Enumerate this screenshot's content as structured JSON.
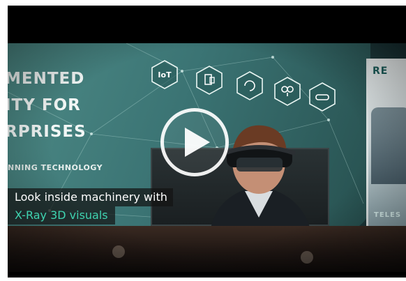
{
  "video": {
    "banner_headline_lines": [
      "MENTED",
      "ITY FOR",
      "RPRISES"
    ],
    "banner_subline": "NNING TECHNOLOGY",
    "hex_badges": [
      {
        "label": "IoT",
        "icon": "iot-icon"
      },
      {
        "label": "",
        "icon": "tablet-icon"
      },
      {
        "label": "",
        "icon": "cycle-icon"
      },
      {
        "label": "",
        "icon": "link-icon"
      },
      {
        "label": "",
        "icon": "headset-icon"
      }
    ],
    "side_banner_brand": "RE",
    "side_banner_text": "TELES",
    "caption_line1": "Look inside machinery with",
    "caption_line2": "X-Ray 3D visuals",
    "play_icon": "play-icon",
    "caption_highlight_color": "#3fd3b0"
  }
}
